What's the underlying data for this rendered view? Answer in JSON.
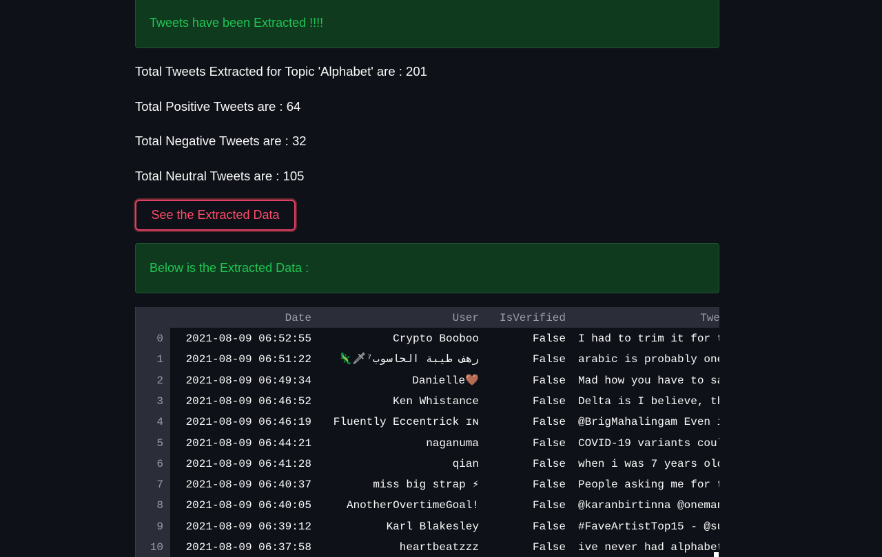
{
  "alerts": {
    "extracted": "Tweets have been Extracted !!!!",
    "below": "Below is the Extracted Data :"
  },
  "stats": {
    "total": "Total Tweets Extracted for Topic 'Alphabet' are : 201",
    "positive": "Total Positive Tweets are : 64",
    "negative": "Total Negative Tweets are : 32",
    "neutral": "Total Neutral Tweets are : 105"
  },
  "button": {
    "label": "See the Extracted Data"
  },
  "colors": {
    "background": "#0e1117",
    "success_bg": "#0f3a1e",
    "success_text": "#21c354",
    "button_accent": "#ff4b6b"
  },
  "table": {
    "headers": {
      "date": "Date",
      "user": "User",
      "verified": "IsVerified",
      "tweet": "Twe"
    },
    "rows": [
      {
        "idx": "0",
        "date": "2021-08-09 06:52:55",
        "user": "Crypto Booboo",
        "verified": "False",
        "tweet": "I had to trim it for t"
      },
      {
        "idx": "1",
        "date": "2021-08-09 06:51:22",
        "user": "🦎🗡رهف طيبة الحاسوب⁷",
        "verified": "False",
        "tweet": "arabic is probably one"
      },
      {
        "idx": "2",
        "date": "2021-08-09 06:49:34",
        "user": "Danielle🤎",
        "verified": "False",
        "tweet": "Mad how you have to sa"
      },
      {
        "idx": "3",
        "date": "2021-08-09 06:46:52",
        "user": "Ken Whistance",
        "verified": "False",
        "tweet": "Delta is I believe, th"
      },
      {
        "idx": "4",
        "date": "2021-08-09 06:46:19",
        "user": "Fluently Eccentrick ɪɴ",
        "verified": "False",
        "tweet": "@BrigMahalingam Even i"
      },
      {
        "idx": "5",
        "date": "2021-08-09 06:44:21",
        "user": "naganuma",
        "verified": "False",
        "tweet": "COVID-19 variants coul"
      },
      {
        "idx": "6",
        "date": "2021-08-09 06:41:28",
        "user": "qian",
        "verified": "False",
        "tweet": "when i was 7 years old"
      },
      {
        "idx": "7",
        "date": "2021-08-09 06:40:37",
        "user": "miss big strap ⚡",
        "verified": "False",
        "tweet": "People asking me for t"
      },
      {
        "idx": "8",
        "date": "2021-08-09 06:40:05",
        "user": "AnotherOvertimeGoal!",
        "verified": "False",
        "tweet": "@karanbirtinna @oneman"
      },
      {
        "idx": "9",
        "date": "2021-08-09 06:39:12",
        "user": "Karl Blakesley",
        "verified": "False",
        "tweet": "#FaveArtistTop15 - @su"
      },
      {
        "idx": "10",
        "date": "2021-08-09 06:37:58",
        "user": "heartbeatzzz",
        "verified": "False",
        "tweet": "ive never had alphabet"
      }
    ]
  }
}
